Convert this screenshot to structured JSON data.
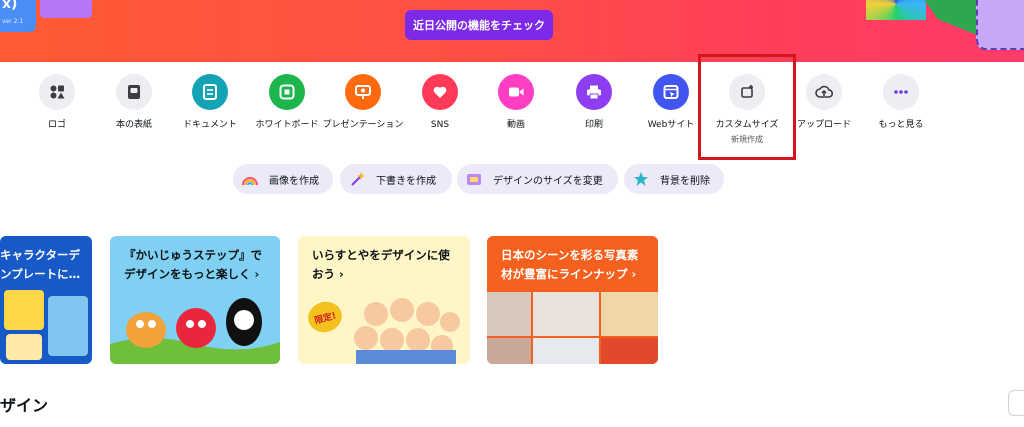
{
  "banner": {
    "cta_label": "近日公開の機能をチェック",
    "left_deco_text": "x)",
    "left_deco_sub": "ver 2.1"
  },
  "quick_actions": [
    {
      "key": "logo",
      "label": "ロゴ",
      "icon": "shapes-icon",
      "color": "#eceef2"
    },
    {
      "key": "book-cover",
      "label": "本の表紙",
      "icon": "book-icon",
      "color": "#eceef2"
    },
    {
      "key": "document",
      "label": "ドキュメント",
      "icon": "document-icon",
      "color": "#13a3b5"
    },
    {
      "key": "whiteboard",
      "label": "ホワイトボード",
      "icon": "whiteboard-icon",
      "color": "#1db54c"
    },
    {
      "key": "presentation",
      "label": "プレゼンテーション",
      "icon": "presentation-icon",
      "color": "#ff6a0e"
    },
    {
      "key": "sns",
      "label": "SNS",
      "icon": "heart-icon",
      "color": "#ff3a59"
    },
    {
      "key": "video",
      "label": "動画",
      "icon": "video-icon",
      "color": "#ff3ec3"
    },
    {
      "key": "print",
      "label": "印刷",
      "icon": "printer-icon",
      "color": "#8d3ef0"
    },
    {
      "key": "website",
      "label": "Webサイト",
      "icon": "website-icon",
      "color": "#4355f0"
    },
    {
      "key": "custom-size",
      "label": "カスタムサイズ",
      "sub": "新規作成",
      "icon": "custom-size-icon",
      "color": "#eceef2"
    },
    {
      "key": "upload",
      "label": "アップロード",
      "icon": "cloud-upload-icon",
      "color": "#eceef2"
    },
    {
      "key": "more",
      "label": "もっと見る",
      "icon": "more-icon",
      "color": "#eceef2"
    }
  ],
  "ai_pills": [
    {
      "label": "画像を作成",
      "icon": "rainbow-icon"
    },
    {
      "label": "下書きを作成",
      "icon": "magic-wand-icon"
    },
    {
      "label": "デザインのサイズを変更",
      "icon": "resize-box-icon"
    },
    {
      "label": "背景を削除",
      "icon": "star-eraser-icon"
    }
  ],
  "cards": [
    {
      "title": "キャラクターデ\nンプレートに…"
    },
    {
      "title": "『かいじゅうステップ』で\nデザインをもっと楽しく ›"
    },
    {
      "title": "いらすとやをデザインに使\nおう ›",
      "badge": "限定!"
    },
    {
      "title": "日本のシーンを彩る写真素\n材が豊富にラインナップ ›"
    }
  ],
  "section": {
    "title": "ザイン"
  },
  "colors": {
    "brand_purple": "#7d2ae8",
    "highlight_red": "#d3161b"
  }
}
